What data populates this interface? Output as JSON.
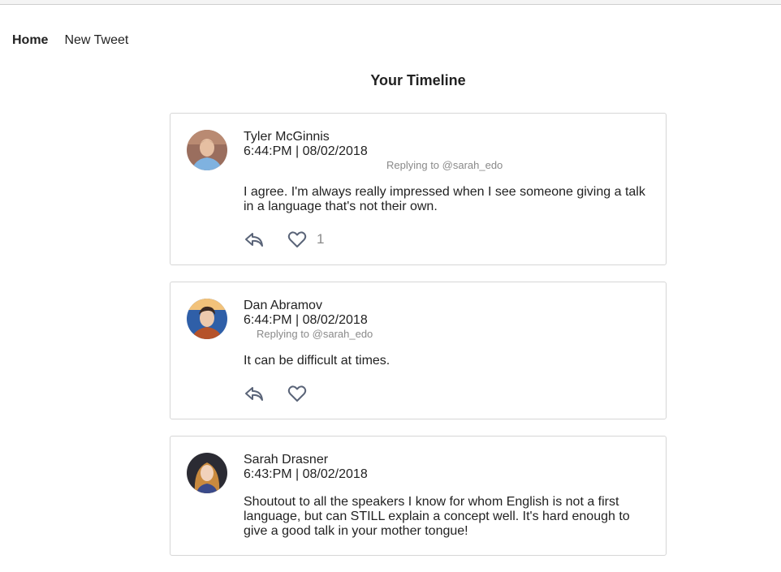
{
  "nav": {
    "home_label": "Home",
    "new_tweet_label": "New Tweet"
  },
  "page": {
    "title": "Your Timeline"
  },
  "tweets": [
    {
      "author": "Tyler McGinnis",
      "timestamp": "6:44:PM | 08/02/2018",
      "replying_to": "Replying to @sarah_edo",
      "text": "I agree. I'm always really impressed when I see someone giving a talk in a language that's not their own.",
      "like_count": "1",
      "avatar_icon": "avatar-photo-icon"
    },
    {
      "author": "Dan Abramov",
      "timestamp": "6:44:PM | 08/02/2018",
      "replying_to": "Replying to @sarah_edo",
      "text": "It can be difficult at times.",
      "like_count": "",
      "avatar_icon": "avatar-photo-icon"
    },
    {
      "author": "Sarah Drasner",
      "timestamp": "6:43:PM | 08/02/2018",
      "replying_to": "",
      "text": "Shoutout to all the speakers I know for whom English is not a first language, but can STILL explain a concept well. It's hard enough to give a good talk in your mother tongue!",
      "like_count": "",
      "avatar_icon": "avatar-photo-icon"
    }
  ],
  "colors": {
    "icon": "#5a6478",
    "muted": "#8a8a8a",
    "border": "#d6d6d6"
  },
  "icons": {
    "reply": "reply-icon",
    "like": "heart-icon"
  }
}
